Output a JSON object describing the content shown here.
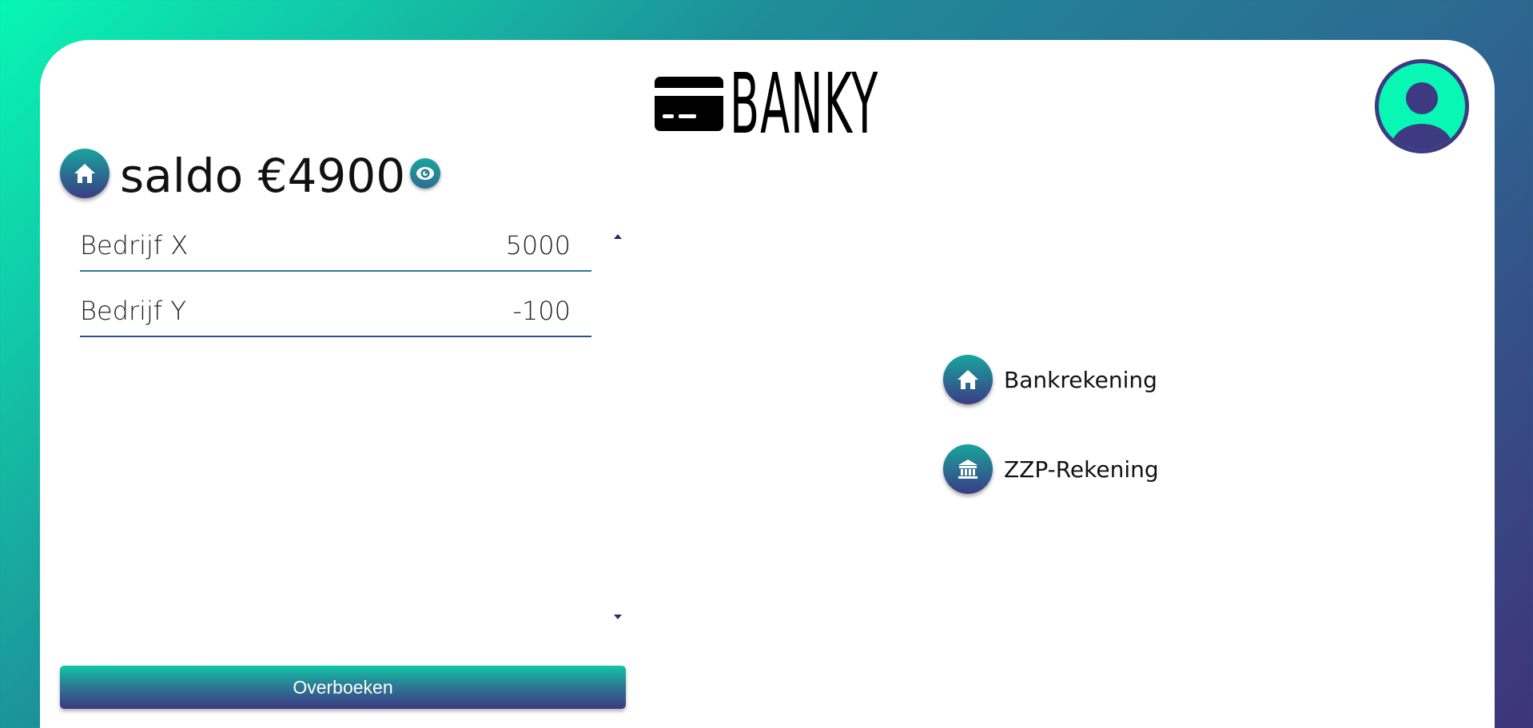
{
  "brand": {
    "name": "BANKY"
  },
  "balance": {
    "text": "saldo €4900"
  },
  "transactions": [
    {
      "name": "Bedrijf X",
      "amount": "5000"
    },
    {
      "name": "Bedrijf Y",
      "amount": "-100"
    }
  ],
  "actions": {
    "transfer_label": "Overboeken"
  },
  "accounts": [
    {
      "label": "Bankrekening",
      "icon": "home-icon"
    },
    {
      "label": "ZZP-Rekening",
      "icon": "bank-icon"
    }
  ],
  "colors": {
    "accent_start": "#08f7b4",
    "accent_end": "#3e347a",
    "avatar_ring": "#3e3a82"
  }
}
